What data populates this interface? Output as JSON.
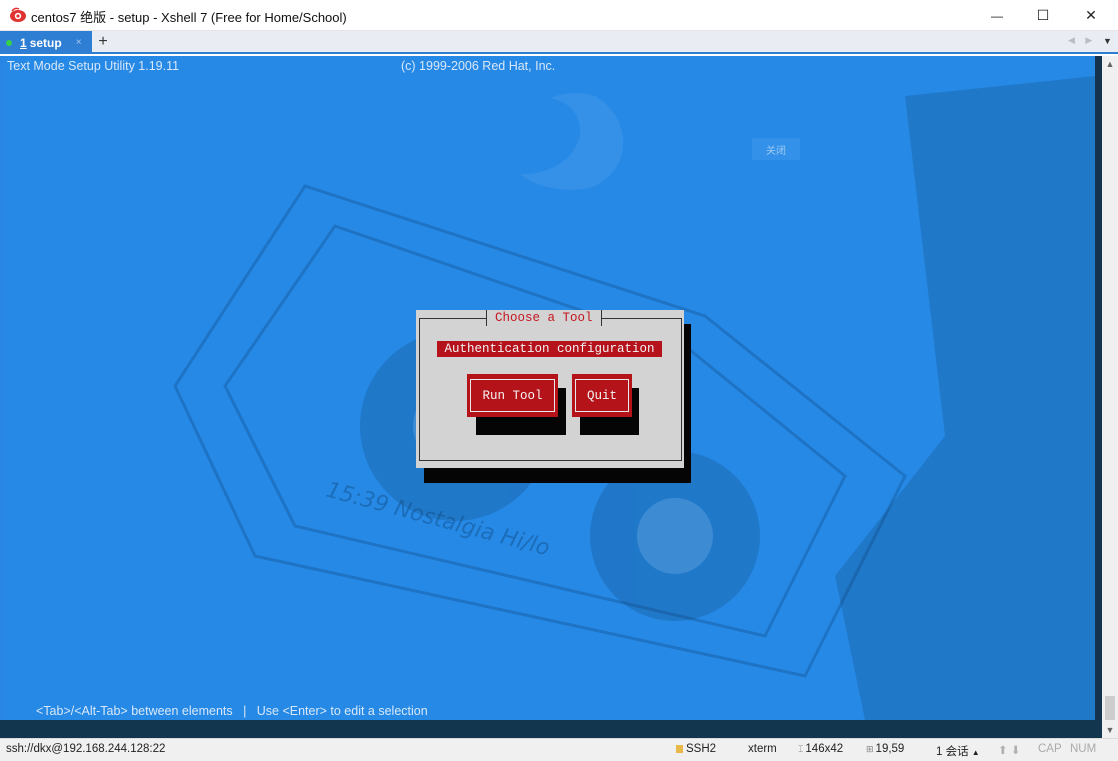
{
  "window": {
    "title": "centos7 绝版 - setup - Xshell 7 (Free for Home/School)",
    "minimize": "—",
    "maximize": "☐",
    "close": "✕"
  },
  "tabs": {
    "items": [
      {
        "number": "1",
        "label": "setup",
        "status_color": "#37d049"
      }
    ],
    "close_glyph": "×",
    "add_glyph": "+",
    "nav_glyphs": "◀ ▶",
    "menu_glyph": "▼"
  },
  "terminal": {
    "header_left": "Text Mode Setup Utility 1.19.11",
    "header_right": "(c) 1999-2006 Red Hat, Inc.",
    "footer_hints": "<Tab>/<Alt-Tab> between elements   |   Use <Enter> to edit a selection",
    "watermark": "关闭",
    "background_color": "#2689e6"
  },
  "dialog": {
    "title": "Choose a Tool",
    "selected_item": "Authentication configuration",
    "buttons": {
      "run": "Run Tool",
      "quit": "Quit"
    },
    "accent_color": "#b5121b"
  },
  "scrollbar": {
    "up": "▲",
    "down": "▼"
  },
  "statusbar": {
    "connection": "ssh://dkx@192.168.244.128:22",
    "protocol": "SSH2",
    "terminal_type": "xterm",
    "size_icon": "⌶",
    "size": "146x42",
    "pos_icon": "⊞",
    "position": "19,59",
    "sessions": "1 会话",
    "sessions_arrow": "▲",
    "arrows": "⬆ ⬇",
    "cap": "CAP",
    "num": "NUM"
  }
}
